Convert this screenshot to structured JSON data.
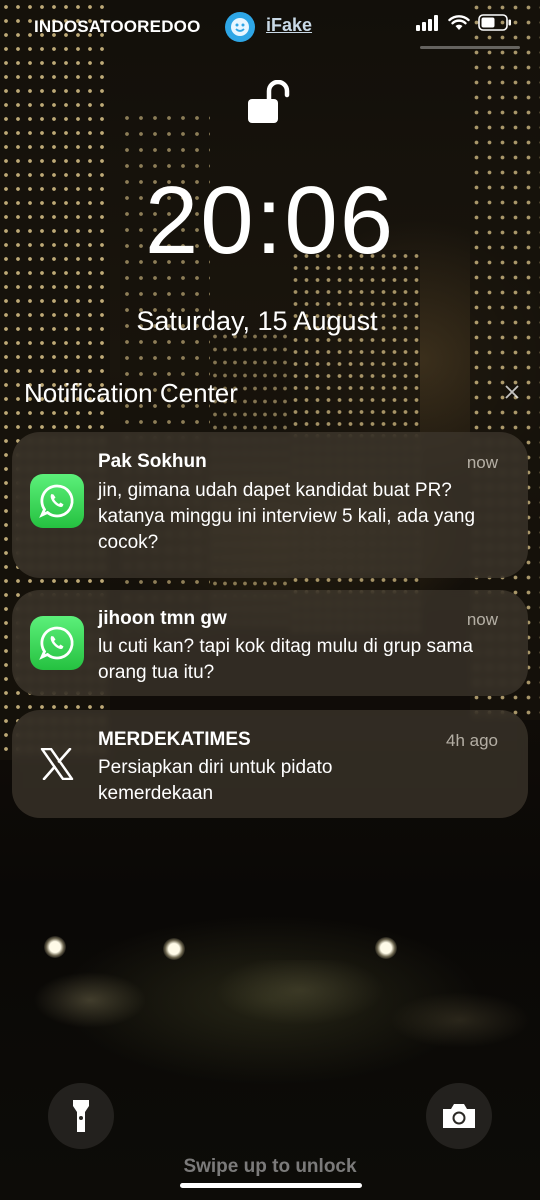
{
  "status_bar": {
    "carrier": "INDOSATOOREDOO",
    "app_badge_label": "iFake",
    "icons": [
      "signal-icon",
      "wifi-icon",
      "battery-icon"
    ]
  },
  "lock_screen": {
    "lock_icon": "unlocked-padlock-icon",
    "time": "20:06",
    "date": "Saturday, 15 August"
  },
  "notification_center": {
    "title": "Notification Center",
    "close_icon": "close-icon",
    "notifications": [
      {
        "app_icon": "whatsapp-icon",
        "sender": "Pak Sokhun",
        "time": "now",
        "message": "jin, gimana udah dapet kandidat buat PR? katanya minggu ini interview 5 kali, ada yang cocok?"
      },
      {
        "app_icon": "whatsapp-icon",
        "sender": "jihoon tmn gw",
        "time": "now",
        "message": "lu cuti kan? tapi kok ditag mulu di grup sama orang tua itu?"
      },
      {
        "app_icon": "x-icon",
        "sender": "MERDEKATIMES",
        "time": "4h ago",
        "message": "Persiapkan diri untuk pidato kemerdekaan"
      }
    ]
  },
  "bottom": {
    "flashlight_icon": "flashlight-icon",
    "camera_icon": "camera-icon",
    "hint": "Swipe up to unlock"
  },
  "colors": {
    "whatsapp_green": "#25c140",
    "ifake_blue": "#2ea6e6",
    "card_bg": "#3e382e"
  }
}
